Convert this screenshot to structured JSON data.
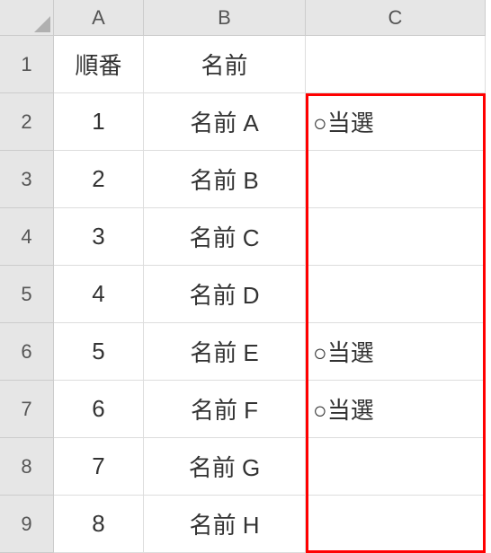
{
  "columns": {
    "A": "A",
    "B": "B",
    "C": "C"
  },
  "rowLabels": {
    "1": "1",
    "2": "2",
    "3": "3",
    "4": "4",
    "5": "5",
    "6": "6",
    "7": "7",
    "8": "8",
    "9": "9"
  },
  "header": {
    "A": "順番",
    "B": "名前",
    "C": ""
  },
  "rows": [
    {
      "A": "1",
      "B": "名前 A",
      "C": "○当選"
    },
    {
      "A": "2",
      "B": "名前 B",
      "C": ""
    },
    {
      "A": "3",
      "B": "名前 C",
      "C": ""
    },
    {
      "A": "4",
      "B": "名前 D",
      "C": ""
    },
    {
      "A": "5",
      "B": "名前 E",
      "C": "○当選"
    },
    {
      "A": "6",
      "B": "名前 F",
      "C": "○当選"
    },
    {
      "A": "7",
      "B": "名前 G",
      "C": ""
    },
    {
      "A": "8",
      "B": "名前 H",
      "C": ""
    }
  ]
}
